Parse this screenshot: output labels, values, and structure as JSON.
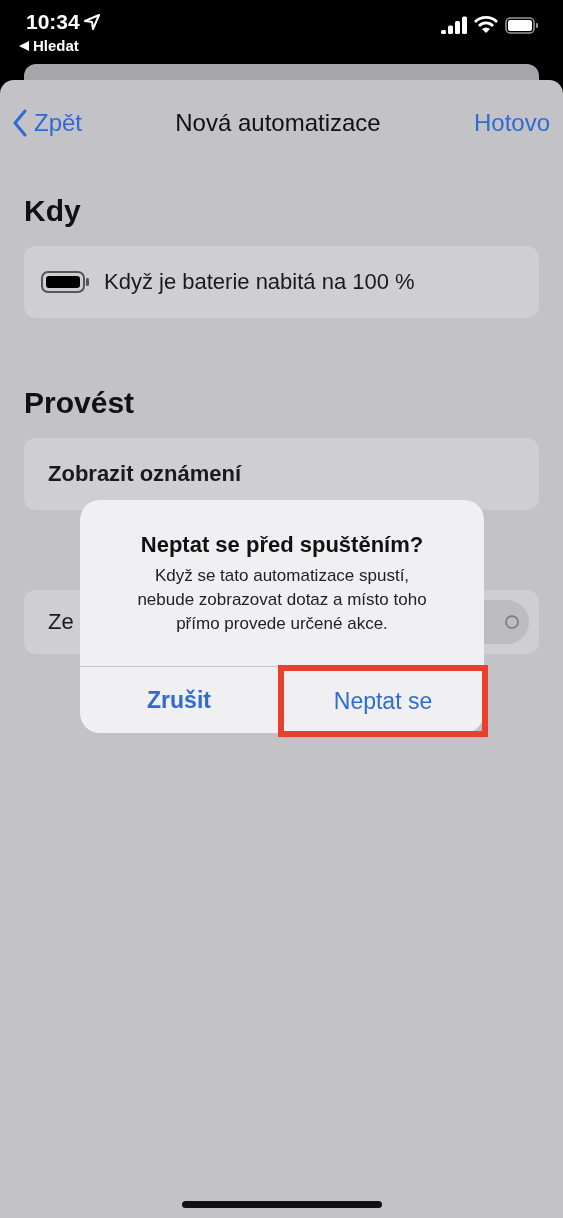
{
  "status_bar": {
    "time": "10:34",
    "back_app": "Hledat"
  },
  "nav": {
    "back": "Zpět",
    "title": "Nová automatizace",
    "done": "Hotovo"
  },
  "sections": [
    {
      "title": "Kdy",
      "rows": [
        {
          "kind": "trigger",
          "label": "Když je baterie nabitá na 100 %"
        }
      ]
    },
    {
      "title": "Provést",
      "rows": [
        {
          "kind": "action",
          "label": "Zobrazit oznámení"
        }
      ]
    }
  ],
  "setting_row": {
    "label": "Ze",
    "on": false
  },
  "alert": {
    "title": "Neptat se před spuštěním?",
    "message": "Když se tato automatizace spustí, nebude zobrazovat dotaz a místo toho přímo provede určené akce.",
    "buttons": [
      {
        "label": "Zrušit",
        "bold": true,
        "highlighted": false
      },
      {
        "label": "Neptat se",
        "bold": false,
        "highlighted": true
      }
    ]
  }
}
